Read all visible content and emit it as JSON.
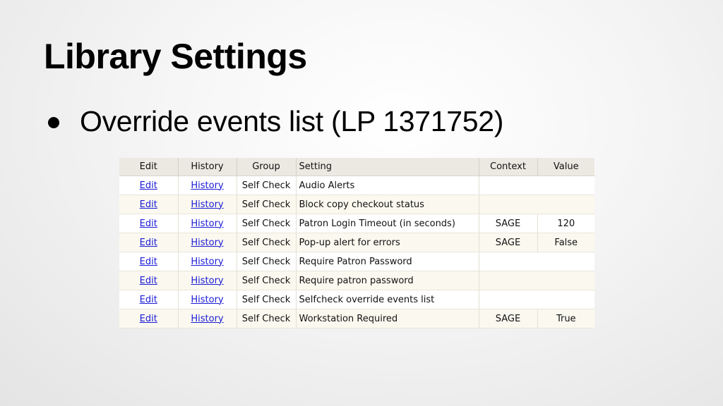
{
  "slide": {
    "title": "Library Settings",
    "bullet": "Override events list (LP 1371752)"
  },
  "table": {
    "headers": {
      "edit": "Edit",
      "history": "History",
      "group": "Group",
      "setting": "Setting",
      "context": "Context",
      "value": "Value"
    },
    "rows": [
      {
        "edit": "Edit",
        "history": "History",
        "group": "Self Check",
        "setting": "Audio Alerts",
        "context": "",
        "value": ""
      },
      {
        "edit": "Edit",
        "history": "History",
        "group": "Self Check",
        "setting": "Block copy checkout status",
        "context": "",
        "value": ""
      },
      {
        "edit": "Edit",
        "history": "History",
        "group": "Self Check",
        "setting": "Patron Login Timeout (in seconds)",
        "context": "SAGE",
        "value": "120"
      },
      {
        "edit": "Edit",
        "history": "History",
        "group": "Self Check",
        "setting": "Pop-up alert for errors",
        "context": "SAGE",
        "value": "False"
      },
      {
        "edit": "Edit",
        "history": "History",
        "group": "Self Check",
        "setting": "Require Patron Password",
        "context": "",
        "value": ""
      },
      {
        "edit": "Edit",
        "history": "History",
        "group": "Self Check",
        "setting": "Require patron password",
        "context": "",
        "value": ""
      },
      {
        "edit": "Edit",
        "history": "History",
        "group": "Self Check",
        "setting": "Selfcheck override events list",
        "context": "",
        "value": ""
      },
      {
        "edit": "Edit",
        "history": "History",
        "group": "Self Check",
        "setting": "Workstation Required",
        "context": "SAGE",
        "value": "True"
      }
    ]
  }
}
